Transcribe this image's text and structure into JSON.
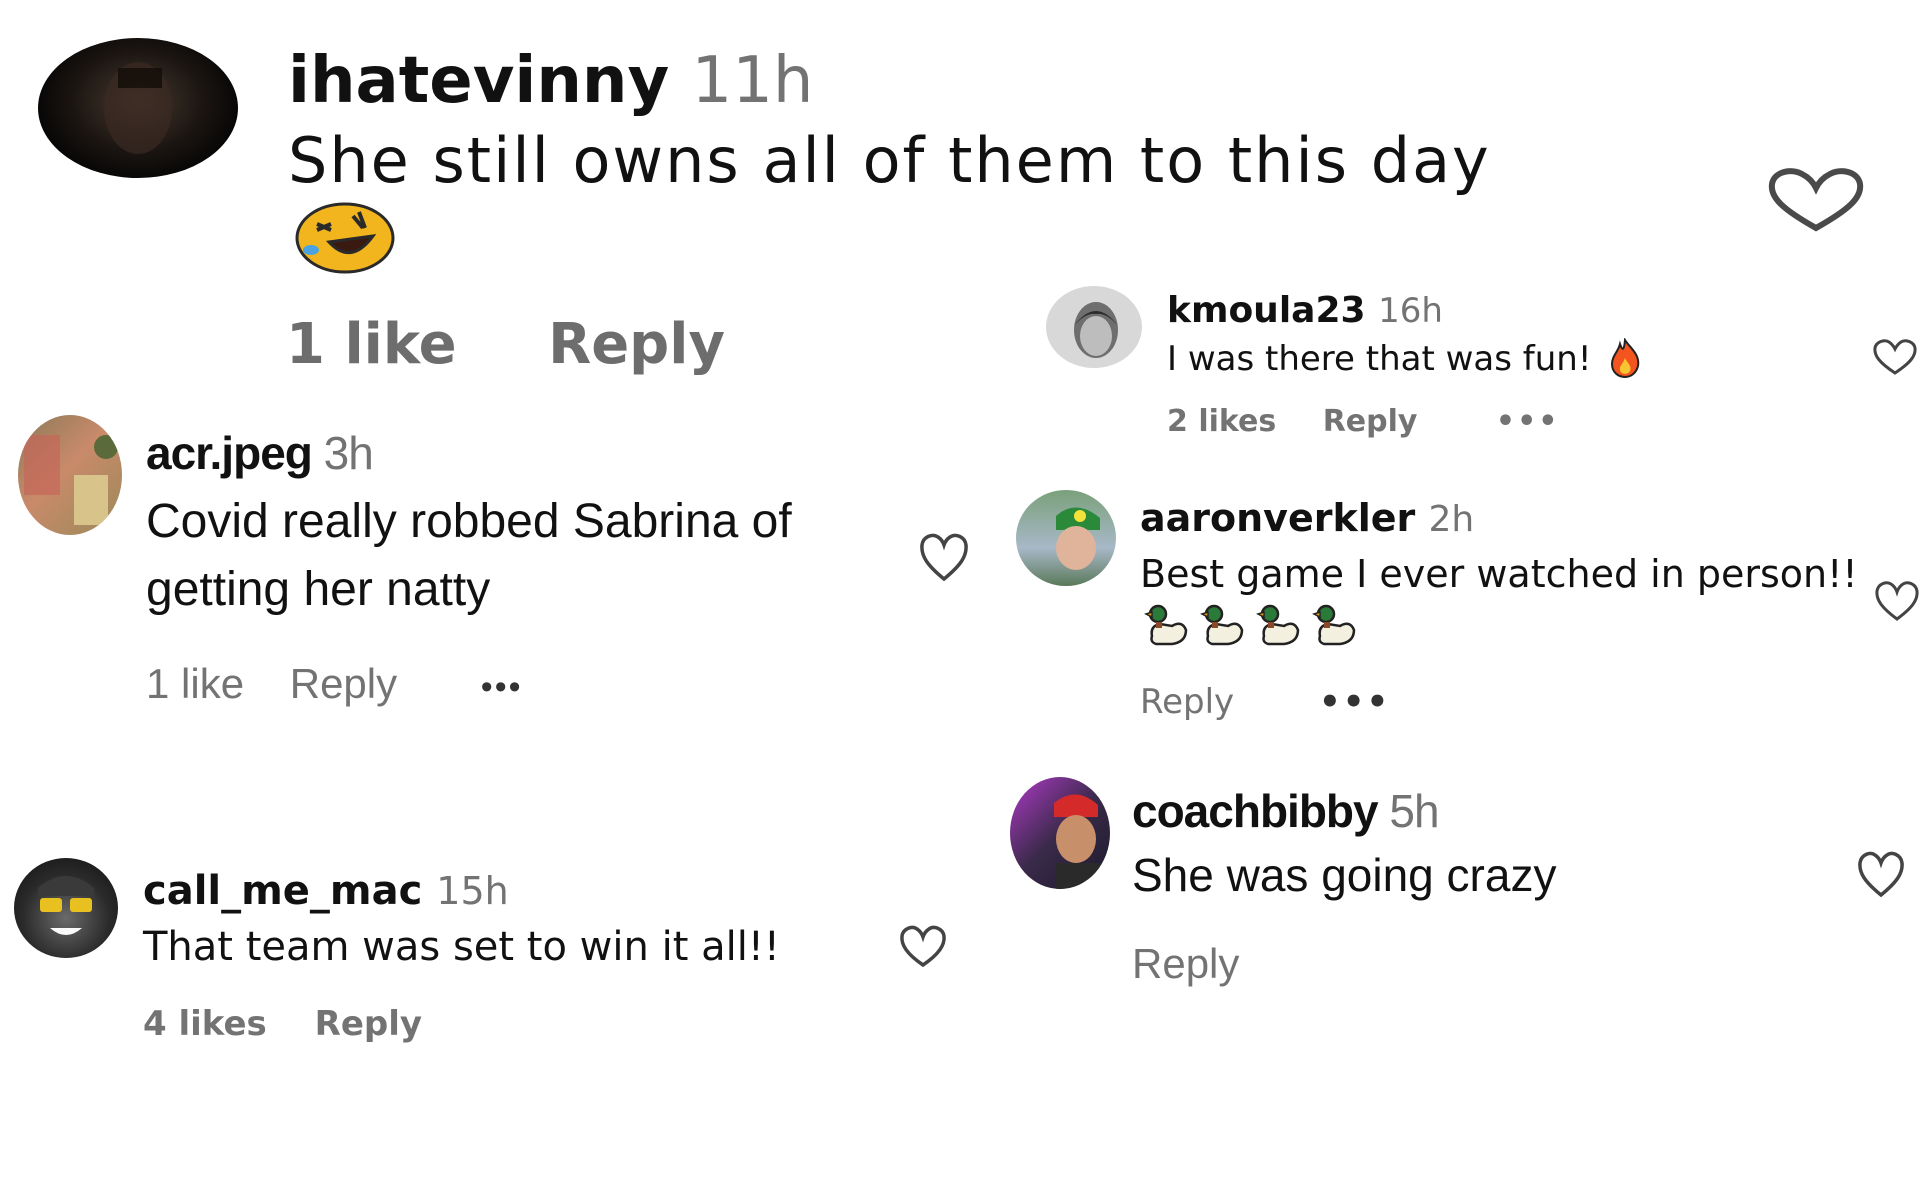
{
  "comments": [
    {
      "username": "ihatevinny",
      "time": "11h",
      "text": "She still owns all of them to this day",
      "emoji": "rofl",
      "likes": "1 like",
      "reply": "Reply"
    },
    {
      "username": "kmoula23",
      "time": "16h",
      "text": "I was there that was fun!",
      "emoji": "fire",
      "likes": "2 likes",
      "reply": "Reply",
      "more": "•••"
    },
    {
      "username": "acr.jpeg",
      "time": "3h",
      "text_line1": "Covid really robbed Sabrina of",
      "text_line2": "getting her natty",
      "likes": "1 like",
      "reply": "Reply",
      "more": "•••"
    },
    {
      "username": "aaronverkler",
      "time": "2h",
      "text": "Best game I ever watched in person!!",
      "emoji": "duck x4",
      "reply": "Reply",
      "more": "•••"
    },
    {
      "username": "coachbibby",
      "time": "5h",
      "text": "She was going crazy",
      "reply": "Reply"
    },
    {
      "username": "call_me_mac",
      "time": "15h",
      "text": "That team was set to win it all!!",
      "likes": "4 likes",
      "reply": "Reply"
    }
  ],
  "icons": {
    "like": "heart-outline-icon",
    "more": "more-options-icon"
  },
  "colors": {
    "text": "#111111",
    "meta": "#737373",
    "heart": "#2a2a2a"
  }
}
